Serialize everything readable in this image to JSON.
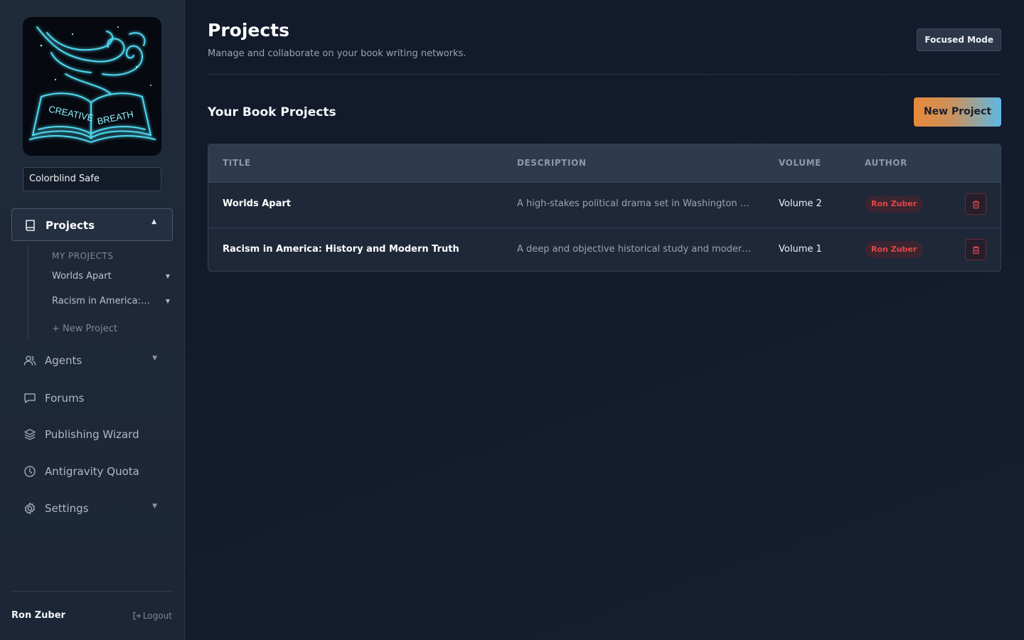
{
  "sidebar": {
    "logo_alt": "CREATIVE BREATH",
    "logo_words": [
      "CREATIVE",
      "BREATH"
    ],
    "theme_select": "Colorblind Safe",
    "nav": {
      "projects": "Projects",
      "agents": "Agents",
      "forums": "Forums",
      "publishing": "Publishing Wizard",
      "quota": "Antigravity Quota",
      "settings": "Settings"
    },
    "projects_sub": {
      "heading": "MY PROJECTS",
      "items": [
        "Worlds Apart",
        "Racism in America: History and Modern Truth"
      ],
      "new_project": "+ New Project"
    },
    "user": "Ron Zuber",
    "logout": "Logout"
  },
  "header": {
    "title": "Projects",
    "subtitle": "Manage and collaborate on your book writing networks.",
    "focused_mode": "Focused Mode"
  },
  "projects_section": {
    "title": "Your Book Projects",
    "new_project_button": "New Project",
    "columns": [
      "TITLE",
      "DESCRIPTION",
      "VOLUME",
      "AUTHOR"
    ],
    "rows": [
      {
        "title": "Worlds Apart",
        "description": "A high-stakes political drama set in Washington D...",
        "volume": "Volume 2",
        "author": "Ron Zuber"
      },
      {
        "title": "Racism in America: History and Modern Truth",
        "description": "A deep and objective historical study and modern ...",
        "volume": "Volume 1",
        "author": "Ron Zuber"
      }
    ]
  },
  "colors": {
    "background": "#121a2b",
    "sidebar": "#1f2a3b",
    "accent_orange": "#e8893a",
    "accent_blue": "#5fb8e4",
    "author_badge_text": "#e04848",
    "logo_glow": "#4fd8f0"
  },
  "icons": {
    "projects": "book-icon",
    "agents": "users-icon",
    "forums": "chat-icon",
    "publishing": "layers-icon",
    "quota": "clock-icon",
    "settings": "gear-icon",
    "delete": "trash-icon",
    "logout": "logout-icon"
  }
}
